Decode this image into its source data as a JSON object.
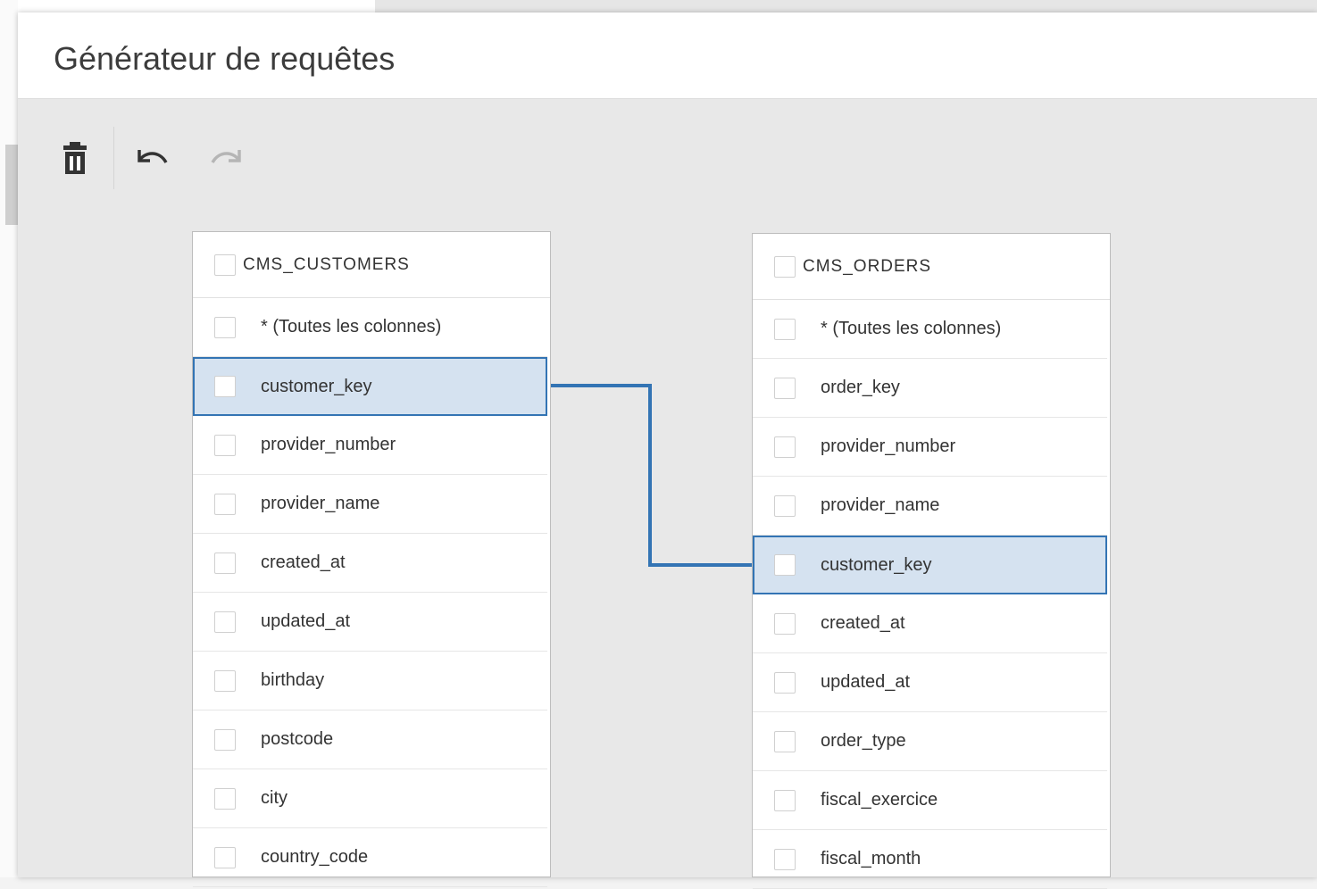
{
  "dialog": {
    "title": "Générateur de requêtes"
  },
  "toolbar": {
    "delete_icon": "trash-icon",
    "undo_icon": "undo-icon",
    "redo_icon": "redo-icon",
    "redo_disabled": true
  },
  "tables": [
    {
      "name": "CMS_CUSTOMERS",
      "columns": [
        "* (Toutes les colonnes)",
        "customer_key",
        "provider_number",
        "provider_name",
        "created_at",
        "updated_at",
        "birthday",
        "postcode",
        "city",
        "country_code"
      ],
      "linked_column": "customer_key"
    },
    {
      "name": "CMS_ORDERS",
      "columns": [
        "* (Toutes les colonnes)",
        "order_key",
        "provider_number",
        "provider_name",
        "customer_key",
        "created_at",
        "updated_at",
        "order_type",
        "fiscal_exercice",
        "fiscal_month"
      ],
      "linked_column": "customer_key"
    }
  ],
  "colors": {
    "link": "#3374b4",
    "selected_row": "#d5e2f0"
  }
}
